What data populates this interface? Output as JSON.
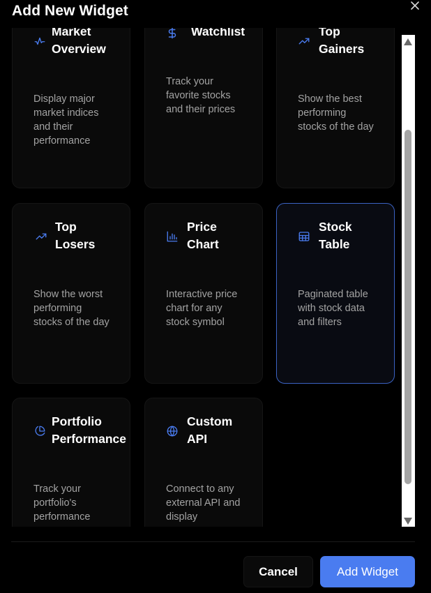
{
  "dialog": {
    "title": "Add New Widget",
    "close_icon": "close-icon"
  },
  "widgets": [
    {
      "id": "market-overview",
      "title": "Market\nOverview",
      "description": "Display major market indices and their performance",
      "icon": "activity-icon",
      "selected": false
    },
    {
      "id": "watchlist",
      "title": "Watchlist",
      "description": "Track your favorite stocks and their prices",
      "icon": "dollar-icon",
      "selected": false
    },
    {
      "id": "top-gainers",
      "title": "Top\nGainers",
      "description": "Show the best performing stocks of the day",
      "icon": "trending-up-icon",
      "selected": false
    },
    {
      "id": "top-losers",
      "title": "Top\nLosers",
      "description": "Show the worst performing stocks of the day",
      "icon": "trending-up-icon",
      "selected": false
    },
    {
      "id": "price-chart",
      "title": "Price\nChart",
      "description": "Interactive price chart for any stock symbol",
      "icon": "bar-chart-icon",
      "selected": false
    },
    {
      "id": "stock-table",
      "title": "Stock\nTable",
      "description": "Paginated table with stock data and filters",
      "icon": "table-icon",
      "selected": true
    },
    {
      "id": "portfolio-performance",
      "title": "Portfolio\nPerformance",
      "description": "Track your portfolio's performance",
      "icon": "pie-chart-icon",
      "selected": false
    },
    {
      "id": "custom-api",
      "title": "Custom\nAPI",
      "description": "Connect to any external API and display",
      "icon": "globe-icon",
      "selected": false
    }
  ],
  "footer": {
    "cancel_label": "Cancel",
    "add_label": "Add Widget"
  },
  "colors": {
    "accent": "#4a7cf0",
    "selected_border": "#3b63c4",
    "background": "#000000",
    "card": "#0a0a0a",
    "muted_text": "#a3a3a3"
  }
}
